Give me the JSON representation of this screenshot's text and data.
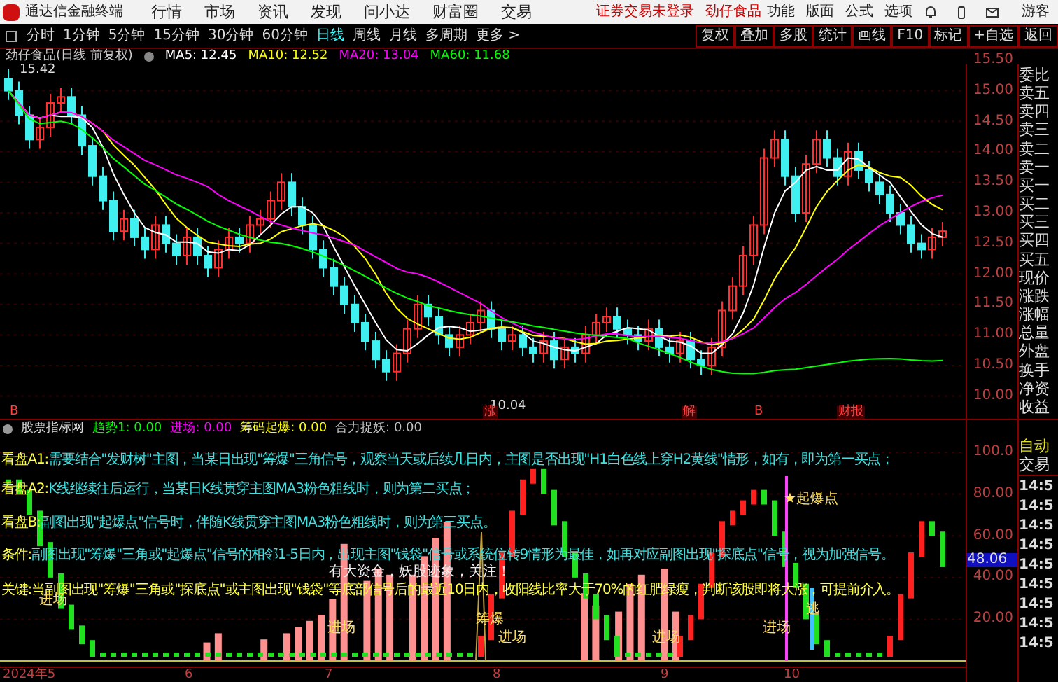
{
  "app": {
    "title": "通达信金融终端",
    "menu": [
      "行情",
      "市场",
      "资讯",
      "发现",
      "问小达",
      "财富圈",
      "交易"
    ],
    "notice": "证券交易未登录",
    "stock": "劲仔食品",
    "tools": [
      "功能",
      "版面",
      "公式",
      "选项"
    ],
    "user": "游客"
  },
  "toolbar": {
    "periods": [
      {
        "label": "分时",
        "selected": false
      },
      {
        "label": "1分钟",
        "selected": false
      },
      {
        "label": "5分钟",
        "selected": false
      },
      {
        "label": "15分钟",
        "selected": false
      },
      {
        "label": "30分钟",
        "selected": false
      },
      {
        "label": "60分钟",
        "selected": false
      },
      {
        "label": "日线",
        "selected": true
      },
      {
        "label": "周线",
        "selected": false
      },
      {
        "label": "月线",
        "selected": false
      },
      {
        "label": "多周期",
        "selected": false
      }
    ],
    "more": "更多 >",
    "buttons": [
      "复权",
      "叠加",
      "多股",
      "统计",
      "画线",
      "F10",
      "标记",
      "+自选",
      "返回"
    ]
  },
  "main_chart": {
    "title": "劲仔食品(日线 前复权)",
    "ma": [
      {
        "label": "MA5: 12.45",
        "color": "#ffffff"
      },
      {
        "label": "MA10: 12.52",
        "color": "#ffff00"
      },
      {
        "label": "MA20: 13.04",
        "color": "#ff00ff"
      },
      {
        "label": "MA60: 11.68",
        "color": "#00ff00"
      }
    ],
    "high_label": "15.42",
    "low_label": "10.04",
    "markers": [
      "B",
      "涨",
      "解",
      "B",
      "财报"
    ],
    "axis": [
      "15.50",
      "15.00",
      "14.50",
      "14.00",
      "13.50",
      "13.00",
      "12.50",
      "12.00",
      "11.50",
      "11.00",
      "10.50",
      "10.00"
    ]
  },
  "indicator": {
    "name": "股票指标网",
    "values": [
      {
        "label": "趋势1: 0.00",
        "color": "#00ff00"
      },
      {
        "label": "进场: 0.00",
        "color": "#ff00ff"
      },
      {
        "label": "筹码起爆: 0.00",
        "color": "#ffff00"
      },
      {
        "label": "合力捉妖: 0.00",
        "color": "#c0c0c0"
      }
    ],
    "notes": [
      {
        "label": "看盘A1:",
        "text": "需要结合\"发财树\"主图，当某日出现\"筹爆\"三角信号，观察当天或后续几日内，主图是否出现\"H1白色线上穿H2黄线\"情形，如有，即为第一买点；",
        "color": "#40e0e0"
      },
      {
        "label": "看盘A2:",
        "text": "K线继续往后运行，当某日K线贯穿主图MA3粉色粗线时，则为第二买点；",
        "color": "#40e0e0"
      },
      {
        "label": "看盘B:",
        "text": "副图出现\"起爆点\"信号时，伴随K线贯穿主图MA3粉色粗线时，则为第三买点。",
        "color": "#40e0e0"
      },
      {
        "label": "条件:",
        "text": "副图出现\"筹爆\"三角或\"起爆点\"信号的相邻1-5日内，出现主图\"钱袋\"信号或系统位转9情形为最佳，如再对应副图出现\"探底点\"信号，视为加强信号。",
        "color": "#40e0e0"
      },
      {
        "label": "关键:",
        "text": "当副图出现\"筹爆\"三角或\"探底点\"或主图出现\"钱袋\"等底部信号后的最近10日内，收阳线比率大于70%的红肥绿瘦，判断该股即将大涨，可提前介入。",
        "color": "#ffff40"
      }
    ],
    "alert": "有大资金，妖股迹象，关注！",
    "signals": [
      "进场",
      "进场",
      "筹爆",
      "进场",
      "进场",
      "进场",
      "★起爆点",
      "逃"
    ],
    "axis": [
      {
        "label": "100.0",
        "current": false
      },
      {
        "label": "80.00",
        "current": false
      },
      {
        "label": "60.00",
        "current": false
      },
      {
        "label": "48.06",
        "current": true
      },
      {
        "label": "40.00",
        "current": false
      },
      {
        "label": "20.00",
        "current": false
      }
    ]
  },
  "dates": [
    "2024年5",
    "6",
    "7",
    "8",
    "9",
    "10"
  ],
  "side_panel": {
    "labels": [
      "委比",
      "卖五",
      "卖四",
      "卖三",
      "卖二",
      "卖一",
      "买一",
      "买二",
      "买三",
      "买四",
      "买五",
      "现价",
      "涨跌",
      "涨幅",
      "总量",
      "外盘",
      "换手",
      "净资",
      "收益"
    ],
    "auto": "自动",
    "trade": "交易",
    "times": [
      "14:5",
      "14:5",
      "14:5",
      "14:5",
      "14:5",
      "14:5",
      "14:5",
      "14:5",
      "14:5"
    ]
  }
}
